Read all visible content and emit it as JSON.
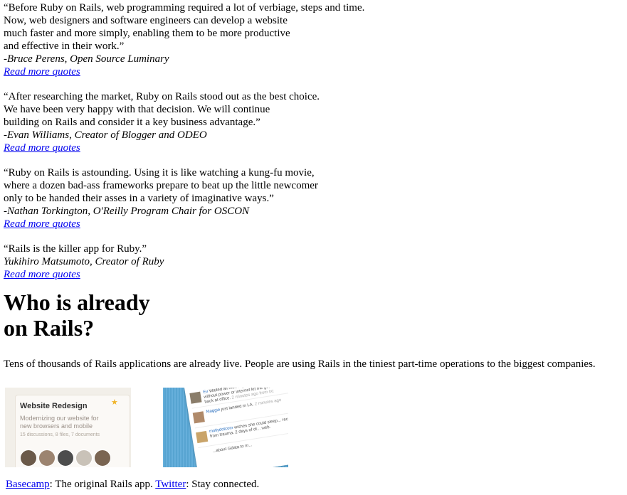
{
  "quotes": [
    {
      "text": "“Before Ruby on Rails, web programming required a lot of verbiage, steps and time.\nNow, web designers and software engineers can develop a website\nmuch faster and more simply, enabling them to be more productive\nand effective in their work.”",
      "author": "-Bruce Perens, Open Source Luminary",
      "link": "Read more quotes"
    },
    {
      "text": "“After researching the market, Ruby on Rails stood out as the best choice.\nWe have been very happy with that decision. We will continue\nbuilding on Rails and consider it a key business advantage.”",
      "author": "-Evan Williams, Creator of Blogger and ODEO",
      "link": "Read more quotes"
    },
    {
      "text": "“Ruby on Rails is astounding. Using it is like watching a kung-fu movie,\nwhere a dozen bad-ass frameworks prepare to beat up the little newcomer\nonly to be handed their asses in a variety of imaginative ways.”",
      "author": "-Nathan Torkington, O'Reilly Program Chair for OSCON",
      "link": "Read more quotes"
    },
    {
      "text": "“Rails is the killer app for Ruby.”",
      "author": "Yukihiro Matsumoto, Creator of Ruby",
      "link": "Read more quotes"
    }
  ],
  "section": {
    "heading": "Who is already\non Rails?",
    "intro": "Tens of thousands of Rails applications are already live. People are using Rails in the tiniest part-time operations to the biggest companies."
  },
  "basecamp_shot": {
    "title": "Website Redesign",
    "description": "Modernizing our website for\nnew browsers and mobile",
    "meta": "15 discussions, 8 files, 7 documents",
    "avatar_colors": [
      "#6b5a4a",
      "#9c8470",
      "#4d4d4d",
      "#c9c2b8",
      "#7a6552"
    ],
    "star_icon": "star-icon"
  },
  "twitter_shot": {
    "rows": [
      {
        "user": "Ev",
        "text": " Waited all morning for PG&E, who did... without power or internet let me get some... over, back at office.",
        "time": " 2 minutes ago from txt"
      },
      {
        "user": "Maggie",
        "text": " just landed in LA.",
        "time": " 2 minutes ago"
      },
      {
        "user": "mollydotcom",
        "text": " wishes she could sleep... recovering from trauma. 2 days of dr... web.",
        "time": ""
      },
      {
        "user": "",
        "text": "...about Gdata to m...",
        "time": ""
      }
    ]
  },
  "caption": {
    "link1": "Basecamp",
    "text1": ": The original Rails app. ",
    "link2": "Twitter",
    "text2": ": Stay connected."
  }
}
